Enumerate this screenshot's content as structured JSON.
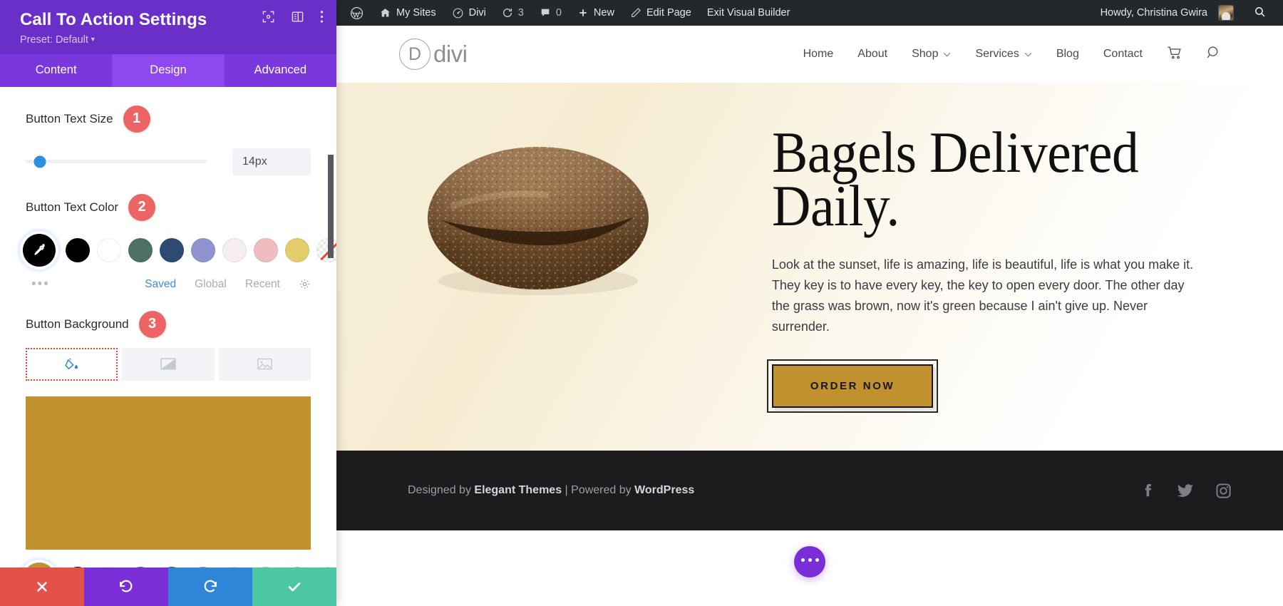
{
  "settings_panel": {
    "title": "Call To Action Settings",
    "preset_label": "Preset: Default",
    "header_icons": [
      {
        "name": "fullscreen-icon"
      },
      {
        "name": "layout-toggle-icon"
      },
      {
        "name": "more-options-icon"
      }
    ],
    "tabs": [
      {
        "label": "Content",
        "active": false
      },
      {
        "label": "Design",
        "active": true
      },
      {
        "label": "Advanced",
        "active": false
      }
    ],
    "fields": {
      "button_text_size": {
        "label": "Button Text Size",
        "step": "1",
        "value": "14px",
        "slider_percent": 8
      },
      "button_text_color": {
        "label": "Button Text Color",
        "step": "2",
        "selected_color": "#000000",
        "swatches": [
          "#000000",
          "#ffffff",
          "#4d7164",
          "#2d4a72",
          "#8f93cf",
          "#f6eeee",
          "#f0bcbf",
          "#e3cc6a",
          "none"
        ],
        "meta": {
          "more": "•••",
          "saved": "Saved",
          "global": "Global",
          "recent": "Recent",
          "gear": "gear-icon"
        }
      },
      "button_background": {
        "label": "Button Background",
        "step": "3",
        "types": [
          {
            "name": "color-fill",
            "active": true
          },
          {
            "name": "gradient",
            "active": false
          },
          {
            "name": "image",
            "active": false
          }
        ],
        "preview_color": "#c1912f",
        "selected_color": "#c1912f",
        "swatches": [
          "#000000",
          "#ffffff",
          "#4d7164",
          "#2d4a72",
          "#8f93cf",
          "#f6eeee",
          "#f0bcbf",
          "#e3cc6a",
          "none"
        ]
      }
    },
    "footer_actions": [
      {
        "name": "cancel",
        "color": "#e2524b"
      },
      {
        "name": "undo",
        "color": "#7a2ed8"
      },
      {
        "name": "redo",
        "color": "#2f86d8"
      },
      {
        "name": "save",
        "color": "#4cc7a4"
      }
    ]
  },
  "admin_bar": {
    "items": [
      {
        "label": "",
        "icon": "wordpress-logo-icon"
      },
      {
        "label": "My Sites",
        "icon": "sites-icon"
      },
      {
        "label": "Divi",
        "icon": "divi-icon"
      },
      {
        "label": "3",
        "icon": "updates-icon"
      },
      {
        "label": "0",
        "icon": "comments-icon"
      },
      {
        "label": "New",
        "icon": "plus-icon"
      },
      {
        "label": "Edit Page",
        "icon": "pencil-icon"
      },
      {
        "label": "Exit Visual Builder",
        "icon": ""
      }
    ],
    "howdy": "Howdy, Christina Gwira",
    "search_icon": "search-icon"
  },
  "site_header": {
    "logo_mark": "D",
    "logo_text": "divi",
    "nav": [
      {
        "label": "Home",
        "has_dropdown": false
      },
      {
        "label": "About",
        "has_dropdown": false
      },
      {
        "label": "Shop",
        "has_dropdown": true
      },
      {
        "label": "Services",
        "has_dropdown": true
      },
      {
        "label": "Blog",
        "has_dropdown": false
      },
      {
        "label": "Contact",
        "has_dropdown": false
      }
    ],
    "cart_icon": "shopping-cart-icon",
    "search_icon": "search-icon"
  },
  "hero": {
    "title": "Bagels Delivered Daily.",
    "body": "Look at the sunset, life is amazing, life is beautiful, life is what you make it. They key is to have every key, the key to open every door. The other day the grass was brown, now it's green because I ain't give up. Never surrender.",
    "button_label": "ORDER NOW",
    "button_bg": "#c1912f",
    "image_alt": "bagel-image"
  },
  "site_footer": {
    "credit_prefix": "Designed by ",
    "credit_brand1": "Elegant Themes",
    "credit_mid": " | Powered by ",
    "credit_brand2": "WordPress",
    "social": [
      {
        "name": "facebook-icon"
      },
      {
        "name": "twitter-icon"
      },
      {
        "name": "instagram-icon"
      }
    ]
  },
  "floating_button": {
    "name": "divi-menu-fab",
    "color": "#7a2ed8"
  }
}
